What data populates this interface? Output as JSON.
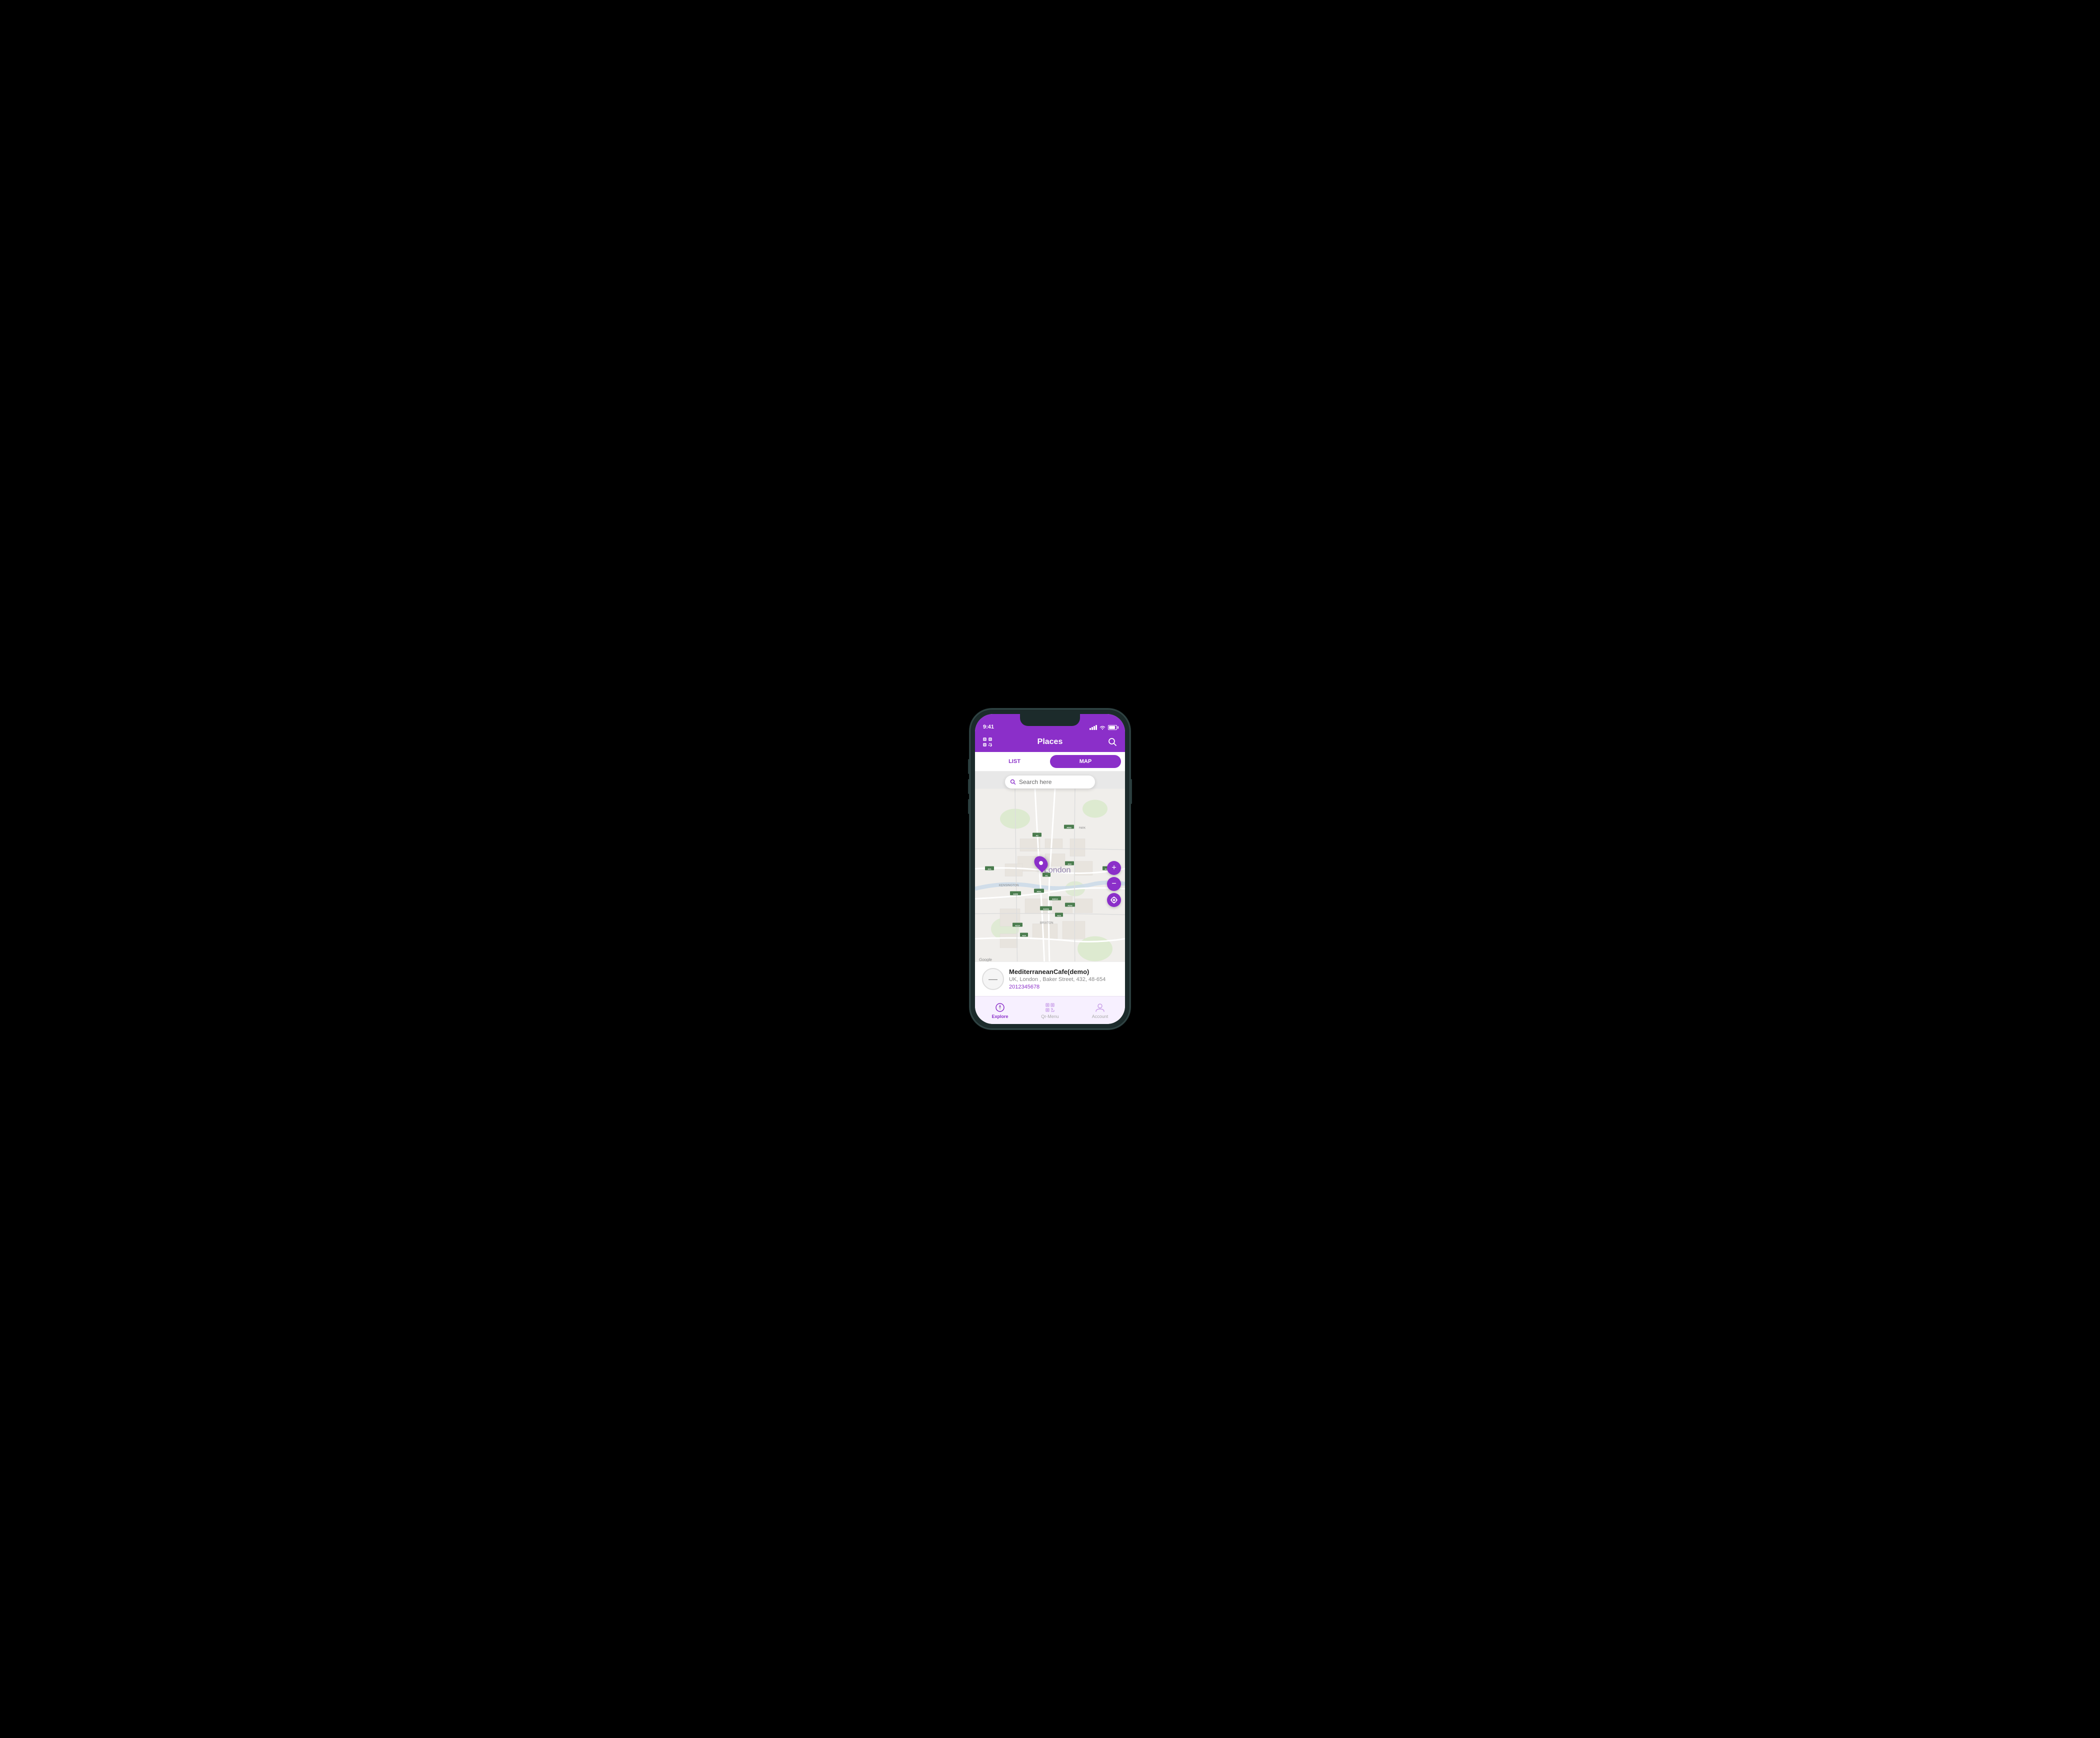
{
  "phone": {
    "status_bar": {
      "time": "9:41",
      "signal_label": "signal",
      "wifi_label": "wifi",
      "battery_label": "battery"
    },
    "header": {
      "title": "Places",
      "left_icon": "qr-scan-icon",
      "right_icon": "search-icon"
    },
    "tabs": {
      "list_label": "LIST",
      "map_label": "MAP",
      "active": "MAP"
    },
    "map": {
      "search_placeholder": "Search here",
      "city_label": "London",
      "zoom_in_label": "+",
      "zoom_out_label": "−",
      "location_label": "⊙",
      "google_label": "Google"
    },
    "place_card": {
      "name": "MediterraneanCafe(demo)",
      "address": "UK, London , Baker Street, 432, 48-654",
      "phone": "2012345678",
      "logo_symbol": "—"
    },
    "bottom_nav": {
      "items": [
        {
          "id": "explore",
          "label": "Explore",
          "icon": "compass-icon",
          "active": true
        },
        {
          "id": "qr-menu",
          "label": "Qr-Menu",
          "icon": "qr-icon",
          "active": false
        },
        {
          "id": "account",
          "label": "Account",
          "icon": "account-icon",
          "active": false
        }
      ]
    }
  },
  "colors": {
    "brand_purple": "#8b2fc9",
    "light_purple_bg": "#f7f0ff",
    "map_bg": "#f0eeeb",
    "text_dark": "#222222",
    "text_muted": "#888888"
  }
}
